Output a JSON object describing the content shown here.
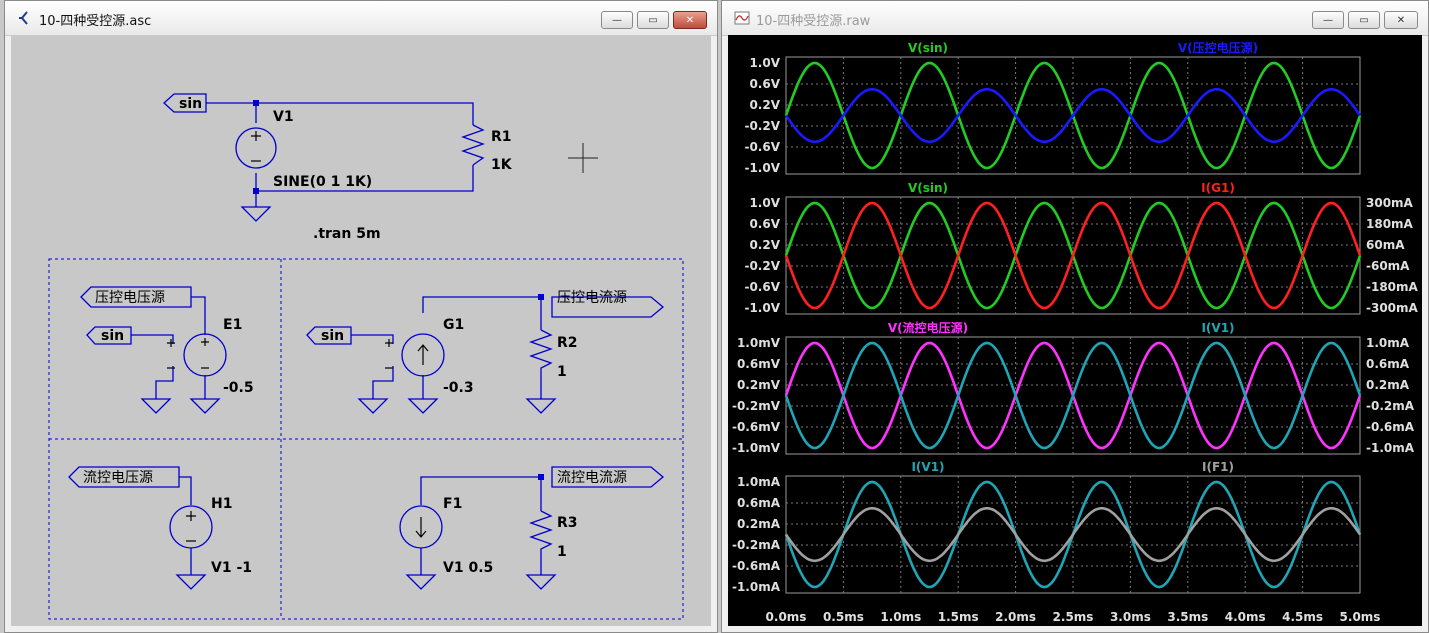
{
  "schematic_window": {
    "title": "10-四种受控源.asc",
    "buttons": {
      "minimize": "—",
      "maximize": "▭",
      "close": "✕"
    }
  },
  "waveform_window": {
    "title": "10-四种受控源.raw",
    "buttons": {
      "minimize": "—",
      "maximize": "▭",
      "close": "✕"
    }
  },
  "schematic": {
    "labels": {
      "sin_top": "sin",
      "V1": "V1",
      "R1": "R1",
      "R1_val": "1K",
      "V1_val": "SINE(0 1 1K)",
      "tran": ".tran 5m",
      "vcvs_net": "压控电压源",
      "sin_e1": "sin",
      "E1": "E1",
      "E1_val": "-0.5",
      "vccs_net": "压控电流源",
      "sin_g1": "sin",
      "G1": "G1",
      "G1_val": "-0.3",
      "R2": "R2",
      "R2_val": "1",
      "ccvs_net": "流控电压源",
      "H1": "H1",
      "H1_val": "V1 -1",
      "cccs_net": "流控电流源",
      "F1": "F1",
      "F1_val": "V1 0.5",
      "R3": "R3",
      "R3_val": "1"
    }
  },
  "panes": [
    {
      "left_ticks": [
        "1.0V",
        "0.6V",
        "0.2V",
        "-0.2V",
        "-0.6V",
        "-1.0V"
      ],
      "right_ticks": [],
      "traces": [
        {
          "name": "V(sin)",
          "color": "#22cc22"
        },
        {
          "name": "V(压控电压源)",
          "color": "#1a1aff"
        }
      ]
    },
    {
      "left_ticks": [
        "1.0V",
        "0.6V",
        "0.2V",
        "-0.2V",
        "-0.6V",
        "-1.0V"
      ],
      "right_ticks": [
        "300mA",
        "180mA",
        "60mA",
        "-60mA",
        "-180mA",
        "-300mA"
      ],
      "traces": [
        {
          "name": "V(sin)",
          "color": "#22cc22"
        },
        {
          "name": "I(G1)",
          "color": "#ff2020"
        }
      ]
    },
    {
      "left_ticks": [
        "1.0mV",
        "0.6mV",
        "0.2mV",
        "-0.2mV",
        "-0.6mV",
        "-1.0mV"
      ],
      "right_ticks": [
        "1.0mA",
        "0.6mA",
        "0.2mA",
        "-0.2mA",
        "-0.6mA",
        "-1.0mA"
      ],
      "traces": [
        {
          "name": "V(流控电压源)",
          "color": "#ff33ff"
        },
        {
          "name": "I(V1)",
          "color": "#1fa5b5"
        }
      ]
    },
    {
      "left_ticks": [
        "1.0mA",
        "0.6mA",
        "0.2mA",
        "-0.2mA",
        "-0.6mA",
        "-1.0mA"
      ],
      "right_ticks": [],
      "traces": [
        {
          "name": "I(V1)",
          "color": "#1fa5b5"
        },
        {
          "name": "I(F1)",
          "color": "#a0a0a0"
        }
      ]
    }
  ],
  "x_axis_ticks": [
    "0.0ms",
    "0.5ms",
    "1.0ms",
    "1.5ms",
    "2.0ms",
    "2.5ms",
    "3.0ms",
    "3.5ms",
    "4.0ms",
    "4.5ms",
    "5.0ms"
  ],
  "chart_data": {
    "type": "line",
    "x_unit": "ms",
    "xlim": [
      0,
      5
    ],
    "frequency_khz": 1,
    "panes": [
      {
        "series": [
          {
            "name": "V(sin)",
            "amplitude": 1.0,
            "phase_deg": 0,
            "unit": "V",
            "axis": "left",
            "ylim": [
              -1,
              1
            ]
          },
          {
            "name": "V(压控电压源)",
            "amplitude": 0.5,
            "phase_deg": 180,
            "unit": "V",
            "axis": "left",
            "ylim": [
              -1,
              1
            ]
          }
        ]
      },
      {
        "series": [
          {
            "name": "V(sin)",
            "amplitude": 1.0,
            "phase_deg": 0,
            "unit": "V",
            "axis": "left",
            "ylim": [
              -1,
              1
            ]
          },
          {
            "name": "I(G1)",
            "amplitude": 0.3,
            "phase_deg": 180,
            "unit": "A",
            "axis": "right",
            "ylim": [
              -0.3,
              0.3
            ]
          }
        ]
      },
      {
        "series": [
          {
            "name": "V(流控电压源)",
            "amplitude": 0.001,
            "phase_deg": 0,
            "unit": "V",
            "axis": "left",
            "ylim": [
              -0.001,
              0.001
            ]
          },
          {
            "name": "I(V1)",
            "amplitude": 0.001,
            "phase_deg": 180,
            "unit": "A",
            "axis": "right",
            "ylim": [
              -0.001,
              0.001
            ]
          }
        ]
      },
      {
        "series": [
          {
            "name": "I(V1)",
            "amplitude": 0.001,
            "phase_deg": 180,
            "unit": "A",
            "axis": "left",
            "ylim": [
              -0.001,
              0.001
            ]
          },
          {
            "name": "I(F1)",
            "amplitude": 0.0005,
            "phase_deg": 180,
            "unit": "A",
            "axis": "left",
            "ylim": [
              -0.001,
              0.001
            ]
          }
        ]
      }
    ],
    "grid": true
  }
}
